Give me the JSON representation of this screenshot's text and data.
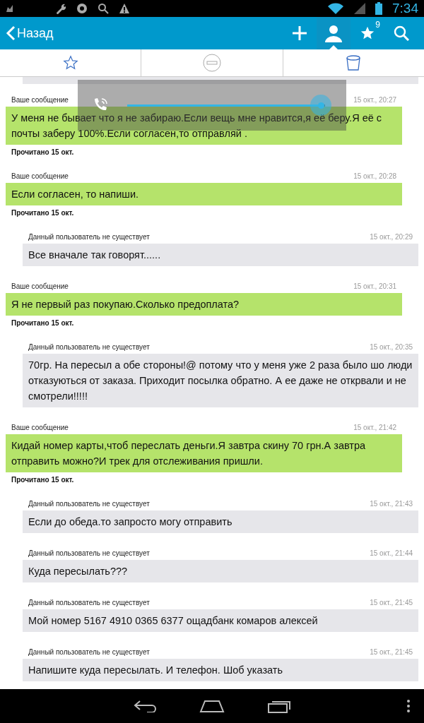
{
  "status_bar": {
    "time": "7:34"
  },
  "action_bar": {
    "back": "Назад",
    "favorites_badge": "9",
    "actions": [
      {
        "kind": "add",
        "selected": false
      },
      {
        "kind": "contacts",
        "selected": true
      },
      {
        "kind": "favorites",
        "selected": false
      },
      {
        "kind": "search",
        "selected": false
      }
    ]
  },
  "tabs": [
    {
      "kind": "star",
      "selected": false
    },
    {
      "kind": "block",
      "selected": false
    },
    {
      "kind": "trash",
      "selected": false
    }
  ],
  "volume": {
    "level": 0.98
  },
  "messages": [
    {
      "kind": "mine",
      "sender": "Ваше сообщение",
      "time": "15 окт., 20:27",
      "text": "У меня не бывает что я не забираю.Если вещь мне нравится,я её беру.Я её с почты заберу 100%.Если согласен,то отправляй .",
      "read": "Прочитано 15 окт."
    },
    {
      "kind": "mine",
      "sender": "Ваше сообщение",
      "time": "15 окт., 20:28",
      "text": "Если согласен, то напиши.",
      "read": "Прочитано 15 окт."
    },
    {
      "kind": "theirs",
      "sender": "Данный пользователь не существует",
      "time": "15 окт., 20:29",
      "text": "Все вначале так говорят......"
    },
    {
      "kind": "mine",
      "sender": "Ваше сообщение",
      "time": "15 окт., 20:31",
      "text": "Я не первый раз покупаю.Сколько предоплата?",
      "read": "Прочитано 15 окт."
    },
    {
      "kind": "theirs",
      "sender": "Данный пользователь не существует",
      "time": "15 окт., 20:35",
      "text": "70гр. На пересыл а обе стороны!@ потому что у меня уже 2 раза было шо люди отказуються от заказа. Приходит посылка обратно. А ее даже не открвали и не смотрели!!!!!"
    },
    {
      "kind": "mine",
      "sender": "Ваше сообщение",
      "time": "15 окт., 21:42",
      "text": "Кидай номер карты,чтоб переслать деньги.Я завтра скину 70 грн.А завтра отправить можно?И трек для отслеживания пришли.",
      "read": "Прочитано 15 окт."
    },
    {
      "kind": "theirs",
      "sender": "Данный пользователь не существует",
      "time": "15 окт., 21:43",
      "text": "Если до обеда.то запросто могу отправить"
    },
    {
      "kind": "theirs",
      "sender": "Данный пользователь не существует",
      "time": "15 окт., 21:44",
      "text": "Куда пересылать???"
    },
    {
      "kind": "theirs",
      "sender": "Данный пользователь не существует",
      "time": "15 окт., 21:45",
      "text": "Мой номер 5167 4910 0365 6377 ощадбанк комаров алексей"
    },
    {
      "kind": "theirs",
      "sender": "Данный пользователь не существует",
      "time": "15 окт., 21:45",
      "text": "Напишите куда пересылать. И телефон. Шоб указать"
    }
  ]
}
